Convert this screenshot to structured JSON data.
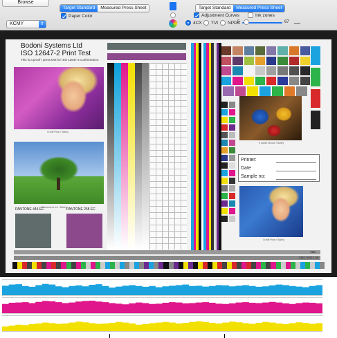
{
  "toolbar": {
    "browse_label": "Browse",
    "left_segment": [
      "Target Standard",
      "Measured Press Sheet"
    ],
    "left_selected": 0,
    "paper_color_label": "Paper Color",
    "paper_color_checked": true,
    "colorspace_value": "KCMY",
    "right_segment": [
      "Target Standard",
      "Measured Press Sheet"
    ],
    "right_selected": 1,
    "adjustment_curves_label": "Adjustment Curves",
    "adjustment_curves_checked": true,
    "ink_zones_label": "Ink zones",
    "ink_zones_checked": false,
    "radio_options": [
      "4CX",
      "TVI",
      "NPDC"
    ],
    "radio_selected": 0,
    "slider_min": "5",
    "slider_max": "67",
    "slider_value": 5,
    "accent_color": "#1a73f0"
  },
  "sheet": {
    "company": "Bodoni Systems Ltd",
    "test_title": "ISO 12647-2 Print Test",
    "subtitle": "This is a proof / press test for ISO 12647-2 conformance.",
    "photo1_caption": "Credit Pixar / Bailey",
    "photo2_caption": "Photoscene Inc / Bailey",
    "photo3_caption": "If Isabel Mouse / Bailey",
    "photo4_caption": "Credit Pixar / Bailey",
    "pantone1_label": "PANTONE 444 EC",
    "pantone2_label": "PANTONE 258 EC",
    "pantone1_color": "#5f6c6b",
    "pantone2_color": "#8c4a8c",
    "form": {
      "printer_label": "Printer:",
      "date_label": "Date",
      "sample_label": "Sample no:"
    },
    "bottom_code_1": "SBB",
    "bottom_code_2": "CMS 1E00 1.06"
  },
  "graphs": {
    "cyan_color": "#1ba3e0",
    "magenta_color": "#e0168c",
    "yellow_color": "#f2e000",
    "cyan_values": [
      0.62,
      0.7,
      0.72,
      0.6,
      0.55,
      0.66,
      0.74,
      0.7,
      0.58,
      0.52,
      0.6,
      0.64,
      0.58,
      0.68,
      0.72,
      0.6,
      0.5,
      0.56,
      0.62,
      0.66,
      0.6,
      0.55,
      0.6,
      0.52,
      0.58,
      0.62,
      0.66,
      0.7,
      0.6,
      0.62,
      0.56,
      0.6,
      0.66,
      0.64,
      0.58,
      0.62,
      0.66,
      0.6,
      0.55,
      0.58,
      0.64,
      0.7,
      0.66,
      0.6,
      0.56,
      0.52,
      0.6,
      0.66
    ],
    "magenta_values": [
      0.6,
      0.68,
      0.7,
      0.72,
      0.66,
      0.74,
      0.8,
      0.78,
      0.72,
      0.66,
      0.7,
      0.76,
      0.8,
      0.82,
      0.76,
      0.72,
      0.66,
      0.62,
      0.58,
      0.64,
      0.7,
      0.66,
      0.6,
      0.62,
      0.68,
      0.72,
      0.7,
      0.64,
      0.66,
      0.7,
      0.72,
      0.68,
      0.62,
      0.6,
      0.64,
      0.7,
      0.72,
      0.68,
      0.66,
      0.7,
      0.74,
      0.7,
      0.64,
      0.6,
      0.66,
      0.7,
      0.68,
      0.64
    ],
    "yellow_values": [
      0.3,
      0.36,
      0.42,
      0.4,
      0.46,
      0.5,
      0.56,
      0.52,
      0.48,
      0.5,
      0.56,
      0.62,
      0.58,
      0.52,
      0.48,
      0.5,
      0.54,
      0.6,
      0.56,
      0.5,
      0.42,
      0.46,
      0.52,
      0.56,
      0.6,
      0.56,
      0.5,
      0.54,
      0.6,
      0.64,
      0.6,
      0.54,
      0.5,
      0.56,
      0.62,
      0.58,
      0.52,
      0.48,
      0.54,
      0.6,
      0.56,
      0.5,
      0.46,
      0.52,
      0.58,
      0.54,
      0.48,
      0.52
    ]
  }
}
